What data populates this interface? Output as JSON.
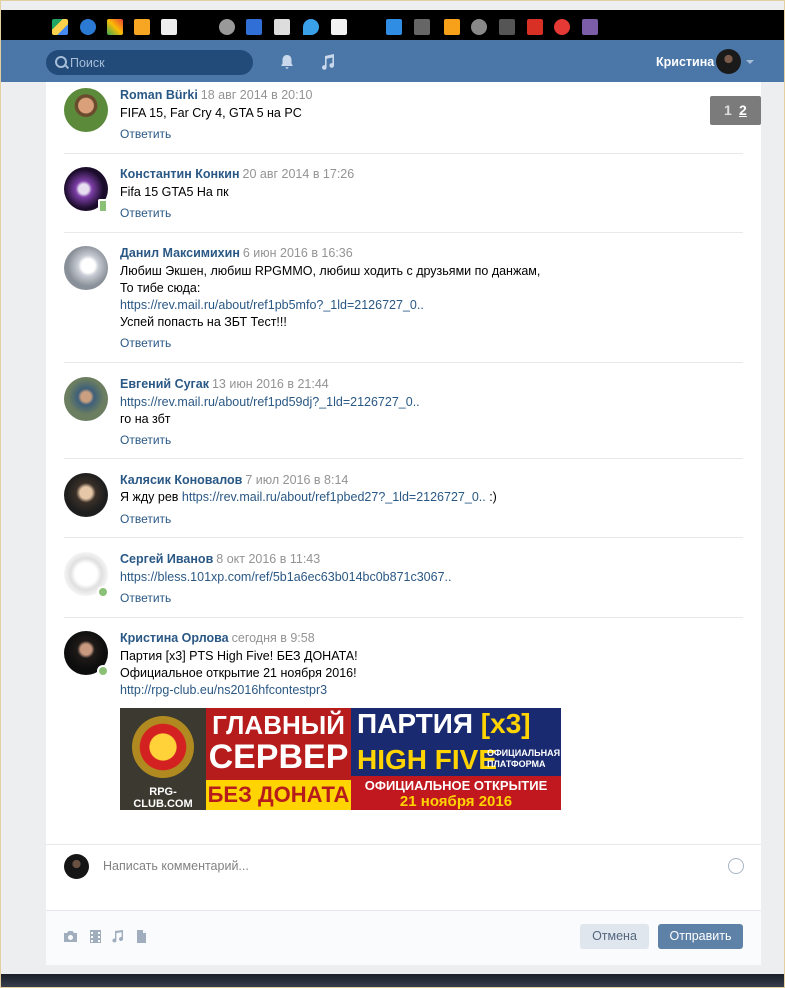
{
  "colors": {
    "header": "#4a76a8",
    "link": "#2a5885",
    "date": "#939393",
    "send_button": "#5e81a8"
  },
  "header": {
    "search_placeholder": "Поиск",
    "user_name": "Кристина"
  },
  "pager": {
    "pages": [
      "1",
      "2"
    ]
  },
  "comments": [
    {
      "author": "Roman Bürki",
      "date": "18 авг 2014 в 20:10",
      "lines": [
        "FIFA 15, Far Cry 4, GTA 5 на PC"
      ],
      "reply": "Ответить"
    },
    {
      "author": "Константин Конкин",
      "date": "20 авг 2014 в 17:26",
      "lines": [
        "Fifa 15 GTA5 На пк"
      ],
      "reply": "Ответить"
    },
    {
      "author": "Данил Максимихин",
      "date": "6 июн 2016 в 16:36",
      "lines": [
        "Любиш Экшен, любиш RPGMMO, любиш ходить с друзьями по данжам,",
        "То тибе сюда:",
        "https://rev.mail.ru/about/ref1pb5mfo?_1ld=2126727_0..",
        "Успей попасть на ЗБТ Тест!!!"
      ],
      "reply": "Ответить"
    },
    {
      "author": "Евгений Сугак",
      "date": "13 июн 2016 в 21:44",
      "lines": [
        "https://rev.mail.ru/about/ref1pd59dj?_1ld=2126727_0..",
        "го на збт"
      ],
      "reply": "Ответить"
    },
    {
      "author": "Калясик Коновалов",
      "date": "7 июл 2016 в 8:14",
      "lines": [
        "Я жду рев ",
        "https://rev.mail.ru/about/ref1pbed27?_1ld=2126727_0..",
        " :)"
      ],
      "reply": "Ответить"
    },
    {
      "author": "Сергей Иванов",
      "date": "8 окт 2016 в 11:43",
      "lines": [
        "https://bless.101xp.com/ref/5b1a6ec63b014bc0b871c3067.."
      ],
      "reply": "Ответить"
    },
    {
      "author": "Кристина Орлова",
      "date": "сегодня в 9:58",
      "lines": [
        "Партия [x3] PTS High Five! БЕЗ ДОНАТА!",
        "Официальное открытие 21 ноября 2016!",
        "http://rpg-club.eu/ns2016hfcontestpr3"
      ]
    }
  ],
  "banner": {
    "club": "RPG-CLUB.COM",
    "main_1": "ГЛАВНЫЙ",
    "main_2": "СЕРВЕР",
    "main_3": "БЕЗ ДОНАТА",
    "party": "ПАРТИЯ",
    "x3": "[x3]",
    "high_five": "HIGH FIVE",
    "official_platform": "ОФИЦИАЛЬНАЯ ПЛАТФОРМА",
    "opening": "ОФИЦИАЛЬНОЕ ОТКРЫТИЕ",
    "opening_date": "21 ноября 2016"
  },
  "compose": {
    "placeholder": "Написать комментарий...",
    "cancel_label": "Отмена",
    "send_label": "Отправить"
  }
}
